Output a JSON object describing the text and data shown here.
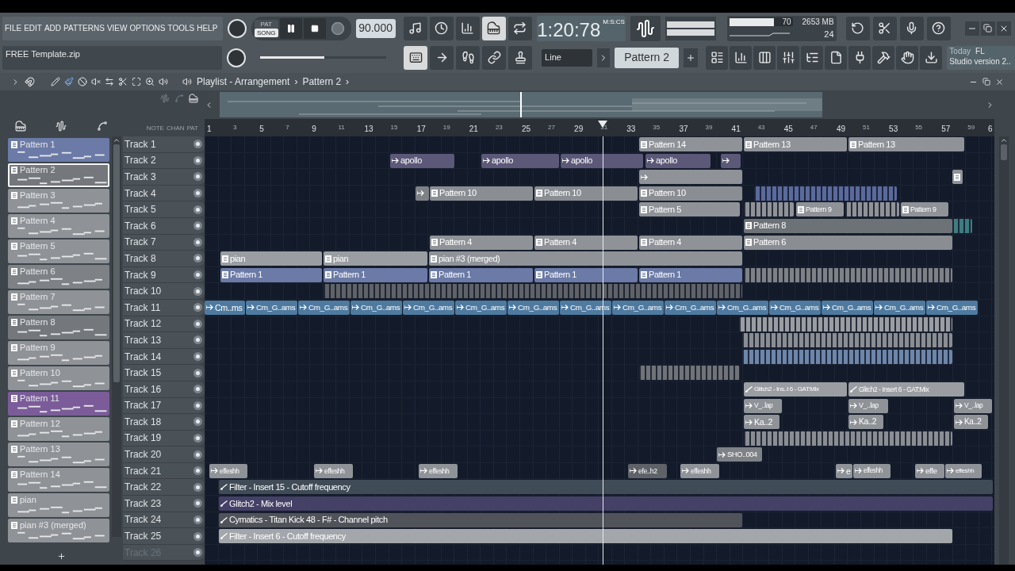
{
  "menu": [
    "FILE",
    "EDIT",
    "ADD",
    "PATTERNS",
    "VIEW",
    "OPTIONS",
    "TOOLS",
    "HELP"
  ],
  "hint": "FREE Template.zip",
  "transport": {
    "modes": [
      {
        "label": "PAT",
        "selected": false
      },
      {
        "label": "SONG",
        "selected": true
      }
    ]
  },
  "tempo": "90.000",
  "time": {
    "value": "1:20:78",
    "unit": "M:S:CS"
  },
  "cpu": {
    "percent": "70",
    "memory": "2653 MB",
    "polyphony": "24",
    "level": 0.7
  },
  "master_volume": {
    "level": 0.51
  },
  "snap": "Line",
  "current_pattern": "Pattern 2",
  "news": {
    "line_1": "Today",
    "line_2": "FL",
    "line_3": "Studio version 2.."
  },
  "playlist": {
    "title": "Playlist - Arrangement",
    "separator": "›",
    "pattern": "Pattern 2",
    "pattern_arrow": "›",
    "columns": [
      "NOTE",
      "CHAN",
      "PAT"
    ]
  },
  "ruler": [
    "1",
    "3",
    "5",
    "7",
    "9",
    "11",
    "13",
    "15",
    "17",
    "19",
    "21",
    "23",
    "25",
    "27",
    "29",
    "31",
    "33",
    "35",
    "37",
    "39",
    "41",
    "43",
    "45",
    "47",
    "49",
    "51",
    "53",
    "55",
    "57",
    "59",
    "6"
  ],
  "patterns": [
    {
      "name": "Pattern 1",
      "color": "#6b7aa6",
      "selected": false
    },
    {
      "name": "Pattern 2",
      "color": "#74787d",
      "selected": true
    },
    {
      "name": "Pattern 3",
      "color": "#8f9398",
      "selected": false
    },
    {
      "name": "Pattern 4",
      "color": "#8f9398",
      "selected": false
    },
    {
      "name": "Pattern 5",
      "color": "#8f9398",
      "selected": false
    },
    {
      "name": "Pattern 6",
      "color": "#7e8287",
      "selected": false
    },
    {
      "name": "Pattern 7",
      "color": "#8f9398",
      "selected": false
    },
    {
      "name": "Pattern 8",
      "color": "#74787d",
      "selected": false
    },
    {
      "name": "Pattern 9",
      "color": "#8f9398",
      "selected": false
    },
    {
      "name": "Pattern 10",
      "color": "#8f9398",
      "selected": false
    },
    {
      "name": "Pattern 11",
      "color": "#7b5c99",
      "selected": false
    },
    {
      "name": "Pattern 12",
      "color": "#8f9398",
      "selected": false
    },
    {
      "name": "Pattern 13",
      "color": "#8f9398",
      "selected": false
    },
    {
      "name": "Pattern 14",
      "color": "#8f9398",
      "selected": false
    },
    {
      "name": "pian",
      "color": "#8f9398",
      "selected": false
    },
    {
      "name": "pian #3 (merged)",
      "color": "#8f9398",
      "selected": false
    }
  ],
  "tracks": [
    {
      "name": "Track 1",
      "clips": [
        {
          "kind": "pattern",
          "label": "Pattern 14",
          "color": "#8f9398"
        },
        {
          "kind": "pattern",
          "label": "Pattern 13",
          "color": "#8f9398"
        },
        {
          "kind": "pattern",
          "label": "Pattern 13",
          "color": "#8f9398"
        }
      ]
    },
    {
      "name": "Track 2",
      "clips": [
        {
          "kind": "audio",
          "label": "apollo",
          "color": "#5b5878"
        },
        {
          "kind": "audio",
          "label": "apollo",
          "color": "#5b5878"
        },
        {
          "kind": "audio",
          "label": "apollo",
          "color": "#5b5878"
        },
        {
          "kind": "audio",
          "label": "apollo",
          "color": "#5b5878"
        },
        {
          "kind": "audio",
          "color": "#5b5878"
        }
      ]
    },
    {
      "name": "Track 3",
      "clips": [
        {
          "kind": "audio",
          "color": "#8f9398"
        },
        {
          "kind": "pattern",
          "color": "#8f9398"
        }
      ]
    },
    {
      "name": "Track 4",
      "clips": [
        {
          "kind": "audio",
          "color": "#7e8287"
        },
        {
          "kind": "pattern",
          "label": "Pattern 10",
          "color": "#8a8e93"
        },
        {
          "kind": "pattern",
          "label": "Pattern 10",
          "color": "#8a8e93"
        },
        {
          "kind": "pattern",
          "label": "Pattern 10",
          "color": "#8a8e93"
        },
        {
          "kind": "slices",
          "color": "#5a6a9c"
        }
      ]
    },
    {
      "name": "Track 5",
      "clips": [
        {
          "kind": "pattern",
          "label": "Pattern 5",
          "color": "#8f9398"
        },
        {
          "kind": "slices",
          "color": "#8f9398"
        },
        {
          "kind": "pattern",
          "label": "Pattern 9",
          "color": "#8f9398"
        },
        {
          "kind": "slices",
          "color": "#8f9398"
        },
        {
          "kind": "pattern",
          "label": "Pattern 9",
          "color": "#8f9398"
        }
      ]
    },
    {
      "name": "Track 6",
      "clips": [
        {
          "kind": "pattern",
          "label": "Pattern 8",
          "color": "#6d7276"
        },
        {
          "kind": "slices",
          "color": "#3e7c82"
        }
      ]
    },
    {
      "name": "Track 7",
      "clips": [
        {
          "kind": "pattern",
          "label": "Pattern 4",
          "color": "#8f9398"
        },
        {
          "kind": "pattern",
          "label": "Pattern 4",
          "color": "#8f9398"
        },
        {
          "kind": "pattern",
          "label": "Pattern 4",
          "color": "#8f9398"
        },
        {
          "kind": "pattern",
          "label": "Pattern 6",
          "color": "#8a8e93"
        }
      ]
    },
    {
      "name": "Track 8",
      "clips": [
        {
          "kind": "pattern",
          "label": "pian",
          "color": "#9a9ea2"
        },
        {
          "kind": "pattern",
          "label": "pian",
          "color": "#9a9ea2"
        },
        {
          "kind": "pattern",
          "label": "pian #3 (merged)",
          "color": "#8f9398"
        }
      ]
    },
    {
      "name": "Track 9",
      "clips": [
        {
          "kind": "pattern",
          "label": "Pattern 1",
          "color": "#6b7aa6"
        },
        {
          "kind": "pattern",
          "label": "Pattern 1",
          "color": "#6b7aa6"
        },
        {
          "kind": "pattern",
          "label": "Pattern 1",
          "color": "#6b7aa6"
        },
        {
          "kind": "pattern",
          "label": "Pattern 1",
          "color": "#6b7aa6"
        },
        {
          "kind": "pattern",
          "label": "Pattern 1",
          "color": "#6b7aa6"
        },
        {
          "kind": "slices",
          "color": "#7e8287"
        }
      ]
    },
    {
      "name": "Track 10",
      "clips": [
        {
          "kind": "slices",
          "color": "#5f6368"
        }
      ]
    },
    {
      "name": "Track 11",
      "clips": [
        {
          "kind": "audio",
          "label": "Cm..ms",
          "color": "#4f7aa0"
        },
        {
          "kind": "audio",
          "label": "Cm_G..ams",
          "color": "#4f7aa0"
        },
        {
          "kind": "audio",
          "label": "Cm_G..ams",
          "color": "#4f7aa0"
        },
        {
          "kind": "audio",
          "label": "Cm_G..ams",
          "color": "#4f7aa0"
        },
        {
          "kind": "audio",
          "label": "Cm_G..ams",
          "color": "#4f7aa0"
        },
        {
          "kind": "audio",
          "label": "Cm_G..ams",
          "color": "#4f7aa0"
        },
        {
          "kind": "audio",
          "label": "Cm_G..ams",
          "color": "#4f7aa0"
        },
        {
          "kind": "audio",
          "label": "Cm_G..ams",
          "color": "#4f7aa0"
        },
        {
          "kind": "audio",
          "label": "Cm_G..ams",
          "color": "#4f7aa0"
        },
        {
          "kind": "audio",
          "label": "Cm_G..ams",
          "color": "#4f7aa0"
        },
        {
          "kind": "audio",
          "label": "Cm_G..ams",
          "color": "#4f7aa0"
        },
        {
          "kind": "audio",
          "label": "Cm_G..ams",
          "color": "#4f7aa0"
        },
        {
          "kind": "audio",
          "label": "Cm_G..ams",
          "color": "#4f7aa0"
        },
        {
          "kind": "audio",
          "label": "Cm_G..ams",
          "color": "#4f7aa0"
        },
        {
          "kind": "audio",
          "label": "Cm_G..ams",
          "color": "#4f7aa0"
        }
      ]
    },
    {
      "name": "Track 12",
      "clips": [
        {
          "kind": "slices",
          "color": "#9a9ea2"
        }
      ]
    },
    {
      "name": "Track 13",
      "clips": [
        {
          "kind": "slices",
          "color": "#8a8e93"
        }
      ]
    },
    {
      "name": "Track 14",
      "clips": [
        {
          "kind": "slices",
          "color": "#6d86aa"
        }
      ]
    },
    {
      "name": "Track 15",
      "clips": [
        {
          "kind": "slices",
          "color": "#707478"
        }
      ]
    },
    {
      "name": "Track 16",
      "clips": [
        {
          "kind": "automation",
          "label": "Glitch2 - Ins..t 6 - GAT:Mix",
          "color": "#9a9ea2"
        },
        {
          "kind": "automation",
          "label": "Glitch2 - Insert 6 - GAT:Mix",
          "color": "#9a9ea2"
        }
      ]
    },
    {
      "name": "Track 17",
      "clips": [
        {
          "kind": "audio",
          "label": "V_..lap",
          "color": "#8f9398"
        },
        {
          "kind": "audio",
          "label": "V_..lap",
          "color": "#8f9398"
        },
        {
          "kind": "audio",
          "label": "V_..lap",
          "color": "#8f9398"
        }
      ]
    },
    {
      "name": "Track 18",
      "clips": [
        {
          "kind": "audio",
          "label": "Ka..2",
          "color": "#8f9398"
        },
        {
          "kind": "audio",
          "label": "Ka..2",
          "color": "#8f9398"
        },
        {
          "kind": "audio",
          "label": "Ka..2",
          "color": "#8f9398"
        }
      ]
    },
    {
      "name": "Track 19",
      "clips": [
        {
          "kind": "slices",
          "color": "#8a8e93"
        }
      ]
    },
    {
      "name": "Track 20",
      "clips": [
        {
          "kind": "audio",
          "label": "SHO..004",
          "color": "#7e8287"
        }
      ]
    },
    {
      "name": "Track 21",
      "clips": [
        {
          "kind": "audio",
          "label": "effeshh",
          "color": "#8f9398"
        },
        {
          "kind": "audio",
          "label": "effeshh",
          "color": "#8f9398"
        },
        {
          "kind": "audio",
          "label": "effeshh",
          "color": "#8f9398"
        },
        {
          "kind": "audio",
          "label": "efe..h2",
          "color": "#5f6368"
        },
        {
          "kind": "audio",
          "label": "effeshh",
          "color": "#8f9398"
        },
        {
          "kind": "audio",
          "label": "e",
          "color": "#8f9398"
        },
        {
          "kind": "audio",
          "label": "effeshh",
          "color": "#8f9398"
        },
        {
          "kind": "audio",
          "label": "effe",
          "color": "#8f9398"
        },
        {
          "kind": "audio",
          "label": "effeshh",
          "color": "#8f9398"
        }
      ]
    },
    {
      "name": "Track 22",
      "clips": [
        {
          "kind": "automation",
          "label": "Filter - Insert 15 - Cutoff frequency",
          "color": "#3f4b56"
        }
      ]
    },
    {
      "name": "Track 23",
      "clips": [
        {
          "kind": "automation",
          "label": "Glitch2 - Mix level",
          "color": "#454066"
        }
      ]
    },
    {
      "name": "Track 24",
      "clips": [
        {
          "kind": "automation",
          "label": "Cymatics - Titan Kick 48 - F# - Channel pitch",
          "color": "#50545a"
        }
      ]
    },
    {
      "name": "Track 25",
      "clips": [
        {
          "kind": "automation",
          "label": "Filter - Insert 6 - Cutoff frequency",
          "color": "#a3a7ab"
        }
      ]
    },
    {
      "name": "Track 26"
    }
  ]
}
